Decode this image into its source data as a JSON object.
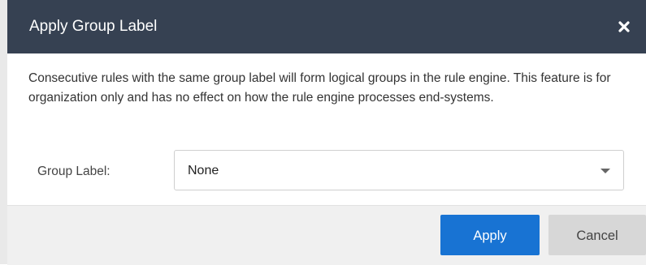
{
  "dialog": {
    "title": "Apply Group Label",
    "close_icon": "close-icon",
    "description": "Consecutive rules with the same group label will form logical groups in the rule engine. This feature is for organization only and has no effect on how the rule engine processes end-systems.",
    "group_label": {
      "label": "Group Label:",
      "selected_value": "None",
      "icon": "chevron-down-icon"
    },
    "buttons": {
      "apply_label": "Apply",
      "cancel_label": "Cancel"
    }
  },
  "colors": {
    "titlebar": "#364152",
    "apply_button": "#1873d3",
    "cancel_button": "#d7d7d7",
    "footer": "#f0f0f0"
  }
}
